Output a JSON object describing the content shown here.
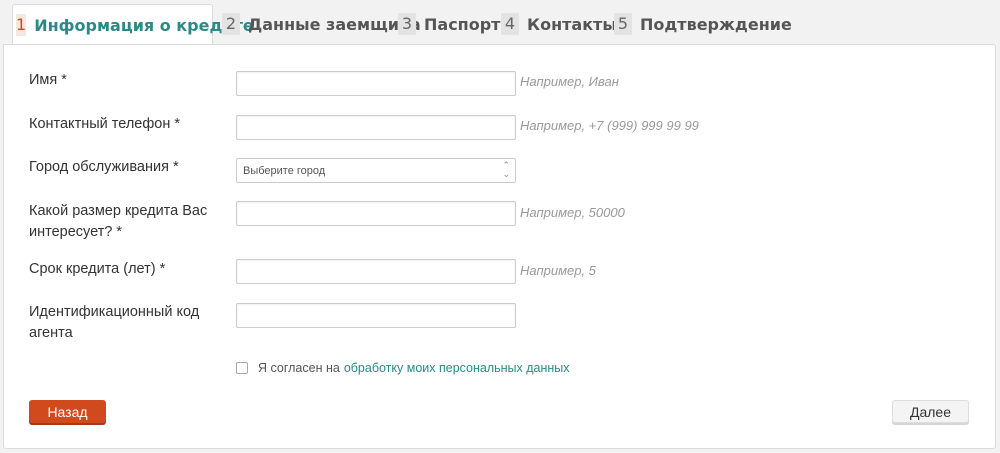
{
  "tabs": [
    {
      "num": "1",
      "label": "Информация о кредите"
    },
    {
      "num": "2",
      "label": "Данные заемщика"
    },
    {
      "num": "3",
      "label": "Паспорт"
    },
    {
      "num": "4",
      "label": "Контакты"
    },
    {
      "num": "5",
      "label": "Подтверждение"
    }
  ],
  "form": {
    "name_label": "Имя *",
    "name_hint": "Например, Иван",
    "phone_label": "Контактный телефон *",
    "phone_hint": "Например, +7 (999) 999 99 99",
    "city_label": "Город обслуживания *",
    "city_value": "Выберите город",
    "amount_label_1": "Какой размер кредита Вас",
    "amount_label_2": "интересует? *",
    "amount_hint": "Например, 50000",
    "term_label": "Срок кредита (лет) *",
    "term_hint": "Например, 5",
    "agent_label_1": "Идентификационный код",
    "agent_label_2": "агента",
    "agree_text": "Я согласен на",
    "agree_link": "обработку моих персональных данных"
  },
  "buttons": {
    "back": "Назад",
    "next": "Далее"
  },
  "colors": {
    "accent": "#2a8a86",
    "back_button": "#d04a1e"
  }
}
